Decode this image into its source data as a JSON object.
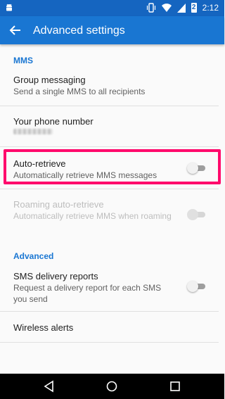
{
  "status_bar": {
    "time": "2:12",
    "battery": "2",
    "icons": [
      "android-icon",
      "vibrate-icon",
      "wifi-icon",
      "signal-icon",
      "battery-icon"
    ]
  },
  "app_bar": {
    "title": "Advanced settings",
    "back_icon": "arrow-back-icon",
    "background": "#1976d2"
  },
  "sections": {
    "mms": {
      "header": "MMS"
    },
    "advanced": {
      "header": "Advanced"
    }
  },
  "prefs": {
    "group_messaging": {
      "title": "Group messaging",
      "summary": "Send a single MMS to all recipients"
    },
    "phone_number": {
      "title": "Your phone number"
    },
    "auto_retrieve": {
      "title": "Auto-retrieve",
      "summary": "Automatically retrieve MMS messages",
      "enabled": false
    },
    "roaming_auto_retrieve": {
      "title": "Roaming auto-retrieve",
      "summary": "Automatically retrieve MMS when roaming",
      "enabled": false,
      "disabled": true
    },
    "sms_delivery_reports": {
      "title": "SMS delivery reports",
      "summary": "Request a delivery report for each SMS you send",
      "enabled": false
    },
    "wireless_alerts": {
      "title": "Wireless alerts"
    }
  },
  "highlight_color": "#ff0a6c",
  "nav_bar": {
    "icons": [
      "back-icon",
      "home-icon",
      "recents-icon"
    ]
  }
}
